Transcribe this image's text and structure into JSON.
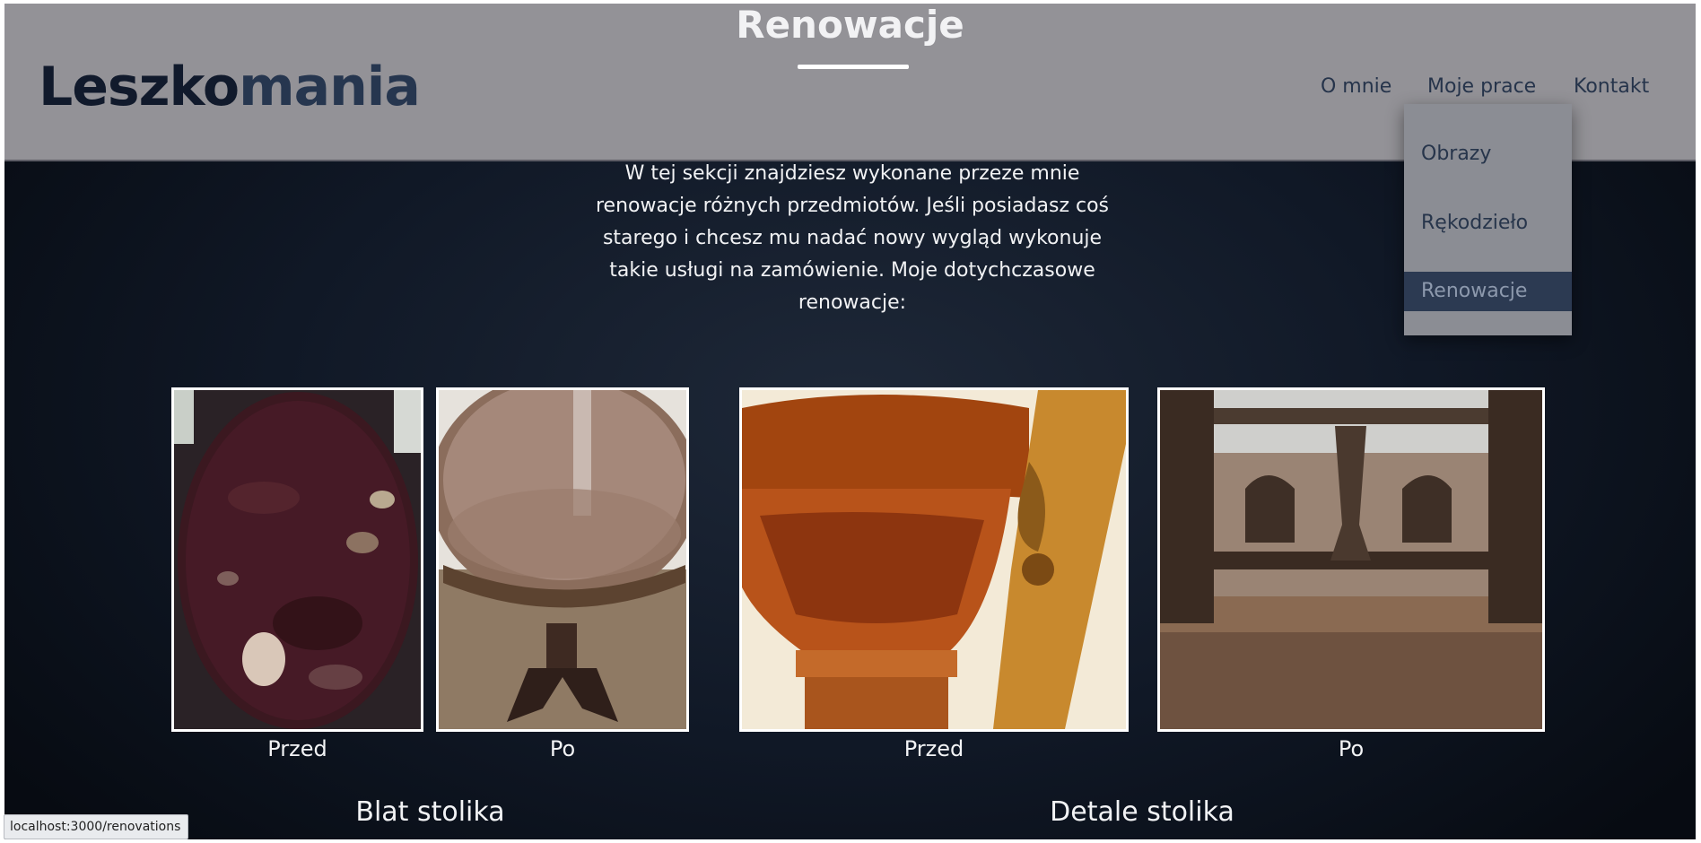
{
  "header": {
    "logo_part1": "Leszko",
    "logo_part2": "mania",
    "section_title": "Renowacje"
  },
  "nav": {
    "items": [
      "O mnie",
      "Moje prace",
      "Kontakt"
    ],
    "dropdown": [
      "Obrazy",
      "Rękodzieło",
      "Renowacje"
    ]
  },
  "main": {
    "intro_lines": [
      "W tej sekcji znajdziesz wykonane przeze mnie",
      "renowacje różnych przedmiotów. Jeśli posiadasz coś",
      "starego i chcesz mu nadać nowy wygląd wykonuje",
      "takie usługi na zamówienie. Moje dotychczasowe",
      "renowacje:"
    ],
    "galleries": [
      {
        "title": "Blat stolika",
        "photos": [
          {
            "caption": "Przed"
          },
          {
            "caption": "Po"
          }
        ]
      },
      {
        "title": "Detale stolika",
        "photos": [
          {
            "caption": "Przed"
          },
          {
            "caption": "Po"
          }
        ]
      }
    ]
  },
  "status_bar": {
    "url": "localhost:3000/renovations"
  },
  "colors": {
    "header_bg": "#939297",
    "page_bg": "#101826",
    "logo_dark": "#111a2c",
    "logo_accent": "#26364f",
    "dropdown_active": "#2c3a52"
  }
}
